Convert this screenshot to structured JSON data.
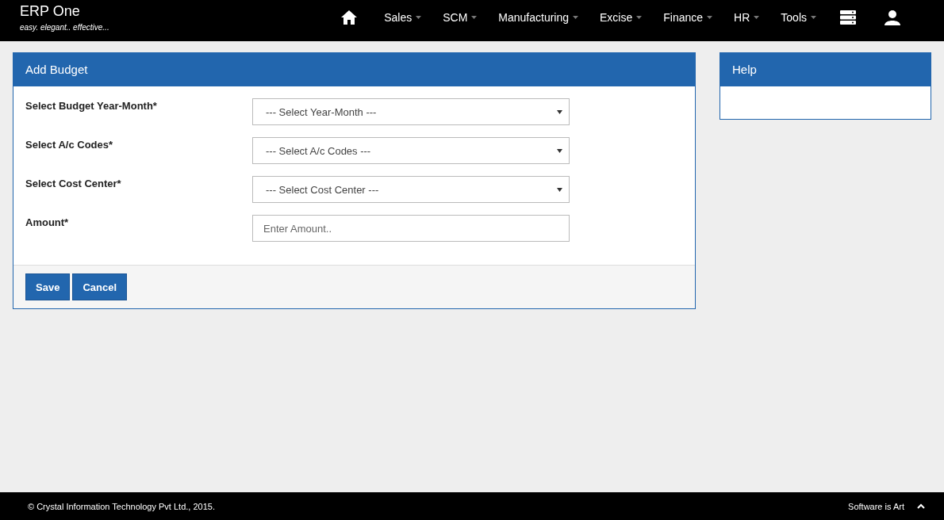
{
  "brand": {
    "title": "ERP One",
    "tagline": "easy. elegant.. effective..."
  },
  "nav": [
    {
      "kind": "home"
    },
    {
      "kind": "menu",
      "label": "Sales"
    },
    {
      "kind": "menu",
      "label": "SCM"
    },
    {
      "kind": "menu",
      "label": "Manufacturing"
    },
    {
      "kind": "menu",
      "label": "Excise"
    },
    {
      "kind": "menu",
      "label": "Finance"
    },
    {
      "kind": "menu",
      "label": "HR"
    },
    {
      "kind": "menu",
      "label": "Tools"
    },
    {
      "kind": "server"
    },
    {
      "kind": "user"
    }
  ],
  "form": {
    "title": "Add Budget",
    "fields": [
      {
        "kind": "select",
        "label": "Select Budget Year-Month*",
        "value": "--- Select Year-Month ---"
      },
      {
        "kind": "select",
        "label": "Select A/c Codes*",
        "value": "--- Select A/c Codes ---"
      },
      {
        "kind": "select",
        "label": "Select Cost Center*",
        "value": "--- Select Cost Center ---"
      },
      {
        "kind": "input",
        "label": "Amount*",
        "placeholder": "Enter Amount.."
      }
    ],
    "buttons": [
      "Save",
      "Cancel"
    ]
  },
  "help": {
    "title": "Help"
  },
  "footer": {
    "copyright": "© Crystal Information Technology Pvt Ltd., 2015.",
    "tagline": "Software is Art"
  }
}
